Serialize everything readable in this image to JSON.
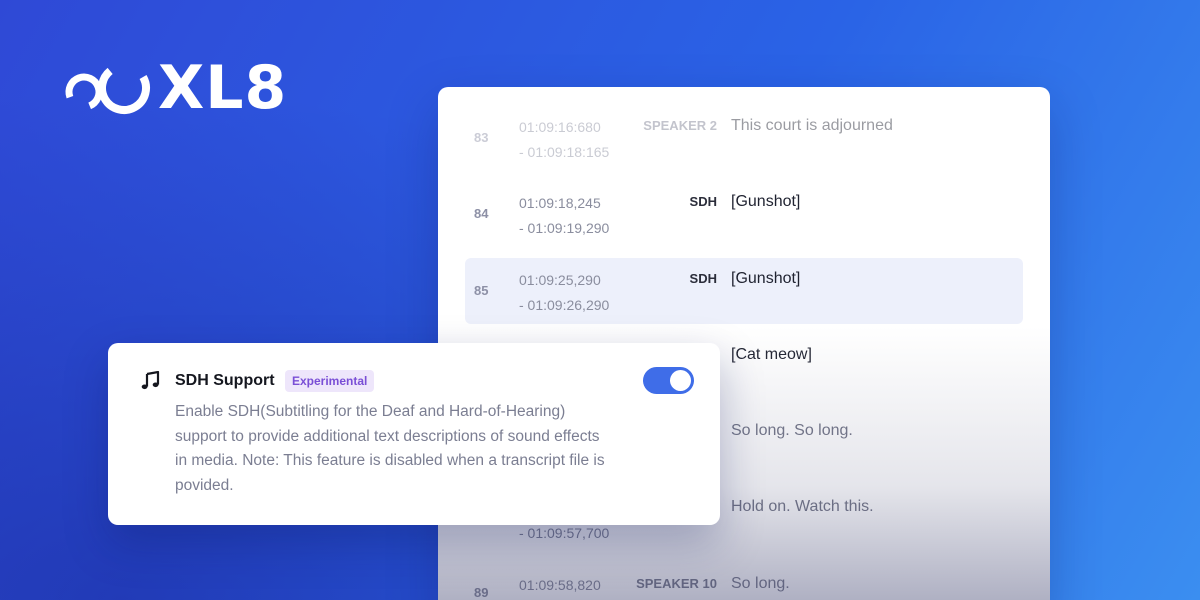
{
  "brand": {
    "name": "XL8"
  },
  "subtitles": [
    {
      "index": "83",
      "start": "01:09:16:680",
      "end": "- 01:09:18:165",
      "speaker": "SPEAKER 2",
      "text": "This court is adjourned"
    },
    {
      "index": "84",
      "start": "01:09:18,245",
      "end": "- 01:09:19,290",
      "speaker": "SDH",
      "text": "[Gunshot]"
    },
    {
      "index": "85",
      "start": "01:09:25,290",
      "end": "- 01:09:26,290",
      "speaker": "SDH",
      "text": "[Gunshot]"
    },
    {
      "index": "",
      "start": "",
      "end": "",
      "speaker": "",
      "text": "[Cat meow]"
    },
    {
      "index": "",
      "start": "",
      "end": "",
      "speaker": "",
      "text": "So long. So long."
    },
    {
      "index": "",
      "start": "",
      "end": "- 01:09:57,700",
      "speaker": "",
      "text": "Hold on. Watch this."
    },
    {
      "index": "89",
      "start": "01:09:58,820",
      "end": "",
      "speaker": "SPEAKER 10",
      "text": "So long."
    }
  ],
  "sdh_card": {
    "title": "SDH Support",
    "badge": "Experimental",
    "description": "Enable SDH(Subtitling for the Deaf and Hard-of-Hearing) support to provide additional text descriptions of sound effects in media. Note: This feature is disabled when a transcript file is povided.",
    "toggle_on": true,
    "icon": "music-note-icon"
  },
  "colors": {
    "accent": "#3f6de8",
    "badge_bg": "#eee6fb",
    "badge_text": "#7a4fd6",
    "highlight_row": "#edf0fb"
  }
}
